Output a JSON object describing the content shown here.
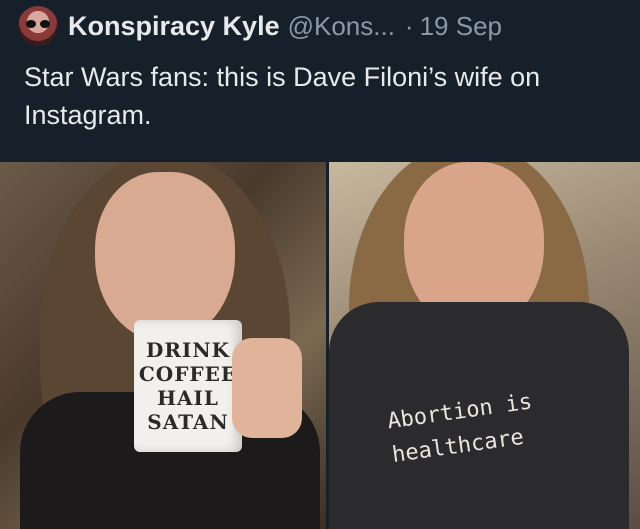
{
  "tweet": {
    "author_name": "Konspiracy Kyle",
    "handle": "@Kons...",
    "separator": "·",
    "date": "19 Sep",
    "text": "Star Wars fans: this is Dave Filoni’s wife on Instagram."
  },
  "photos": {
    "left": {
      "mug_lines": [
        "DRINK",
        "COFFEE",
        "HAIL",
        "SATAN"
      ]
    },
    "right": {
      "shirt_lines": [
        "Abortion is",
        "healthcare"
      ]
    }
  },
  "colors": {
    "background": "#15202b",
    "text_primary": "#e7e9ea",
    "text_secondary": "#8b98a5"
  }
}
